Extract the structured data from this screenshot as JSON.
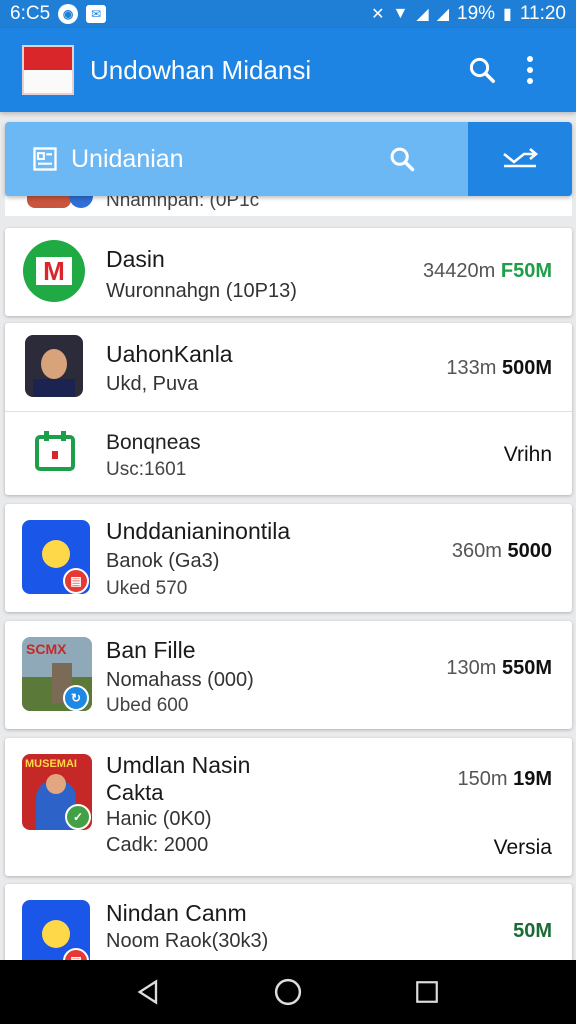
{
  "status": {
    "time_left": "6:C5",
    "battery": "19%",
    "time_right": "11:20"
  },
  "app_bar": {
    "title": "Undowhan Midansi"
  },
  "search": {
    "label": "Unidanian"
  },
  "peek": {
    "text": "Nhamhpah: (0P1c"
  },
  "items": [
    {
      "title": "Dasin",
      "sub": "Wuronnahgn (10P13)",
      "meta": "34420m",
      "size": "F50M"
    },
    {
      "title": "UahonKanla",
      "sub": "Ukd, Puva",
      "meta": "133m",
      "size": "500M"
    },
    {
      "title": "Bonqneas",
      "sub": "Usc:1601",
      "meta": "",
      "size": "Vrihn"
    },
    {
      "title": "Unddanianinontila",
      "sub": "Banok (Ga3)",
      "sub2": "Uked 570",
      "meta": "360m",
      "size": "5000"
    },
    {
      "title": "Ban Fille",
      "sub": "Nomahass (000)",
      "sub2": "Ubed 600",
      "meta": "130m",
      "size": "550M"
    },
    {
      "title": "Umdlan Nasin",
      "sub": "Cakta",
      "sub2": "Hanic (0K0)",
      "sub3": "Cadk: 2000",
      "meta": "150m",
      "size": "19M",
      "extra": "Versia"
    },
    {
      "title": "Nindan Canm",
      "sub": "Noom Raok(30k3)",
      "meta": "",
      "size": "50M"
    }
  ],
  "colors": {
    "status_bar": "#1f7fd6",
    "app_bar": "#1e84e4",
    "search_bar": "#6cb8f4",
    "accent_green": "#1f9e4a"
  }
}
